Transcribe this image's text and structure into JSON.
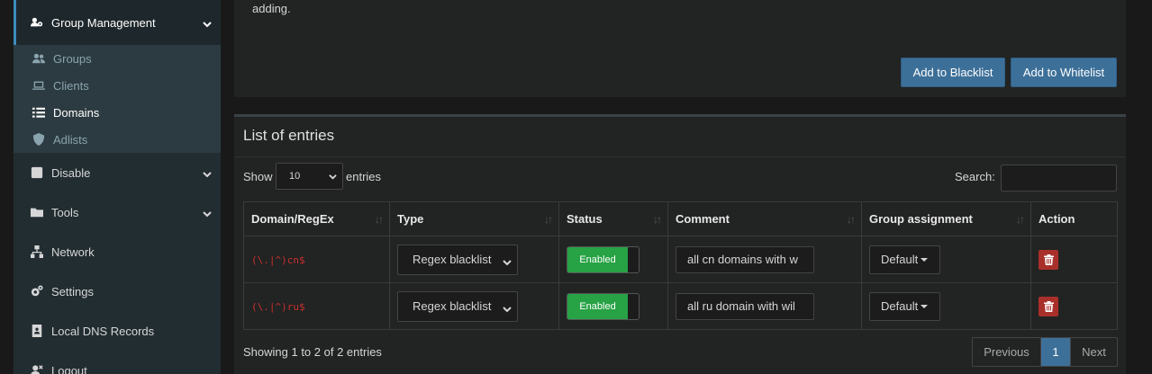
{
  "sidebar": {
    "group_management": {
      "label": "Group Management",
      "icon": "users-gear-icon"
    },
    "sub_items": [
      {
        "label": "Groups",
        "icon": "users-icon"
      },
      {
        "label": "Clients",
        "icon": "laptop-icon"
      },
      {
        "label": "Domains",
        "icon": "list-icon",
        "active": true
      },
      {
        "label": "Adlists",
        "icon": "shield-icon"
      }
    ],
    "items": [
      {
        "label": "Disable",
        "icon": "stop-icon"
      },
      {
        "label": "Tools",
        "icon": "folder-icon"
      },
      {
        "label": "Network",
        "icon": "network-icon"
      },
      {
        "label": "Settings",
        "icon": "cogs-icon"
      },
      {
        "label": "Local DNS Records",
        "icon": "address-book-icon"
      },
      {
        "label": "Logout",
        "icon": "user-times-icon"
      }
    ]
  },
  "add_box": {
    "text_fragment": "adding.",
    "add_blacklist_label": "Add to Blacklist",
    "add_whitelist_label": "Add to Whitelist"
  },
  "list": {
    "title": "List of entries",
    "show_label": "Show",
    "page_length": "10",
    "entries_label": "entries",
    "search_label": "Search:",
    "columns": [
      "Domain/RegEx",
      "Type",
      "Status",
      "Comment",
      "Group assignment",
      "Action"
    ],
    "rows": [
      {
        "domain": "(\\.|^)cn$",
        "type": "Regex blacklist",
        "status": "Enabled",
        "comment": "all cn domains with w",
        "group": "Default"
      },
      {
        "domain": "(\\.|^)ru$",
        "type": "Regex blacklist",
        "status": "Enabled",
        "comment": "all ru domain with wil",
        "group": "Default"
      }
    ],
    "info": "Showing 1 to 2 of 2 entries",
    "pagination": {
      "previous": "Previous",
      "current": "1",
      "next": "Next"
    }
  },
  "colors": {
    "accent": "#3d7099",
    "enabled_green": "#27a244",
    "delete_red": "#a9302a",
    "regex_red": "#c9302c"
  }
}
